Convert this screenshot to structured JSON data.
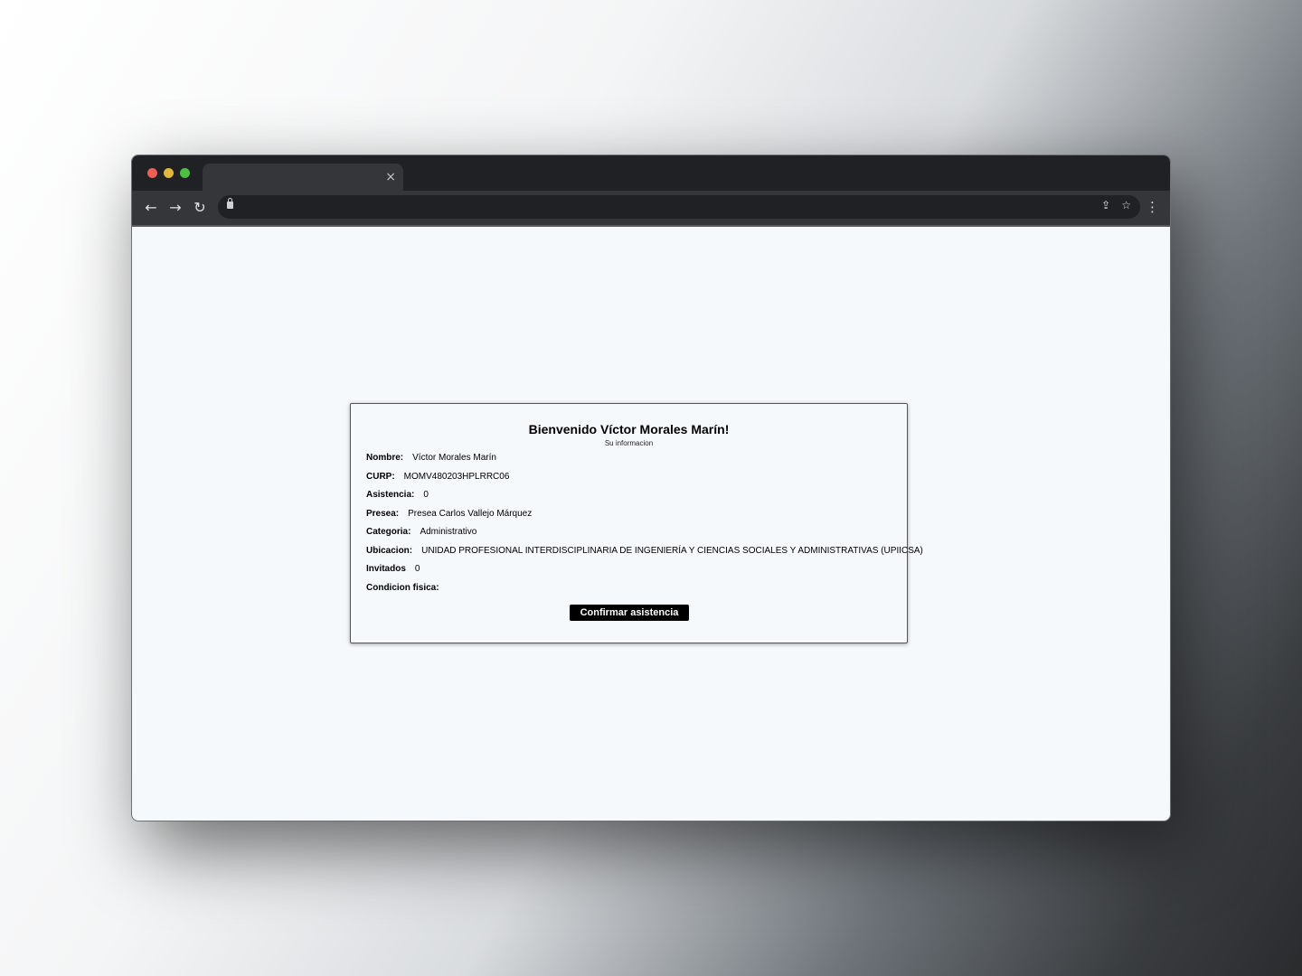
{
  "browser": {
    "tab_close": "×",
    "nav": {
      "back": "←",
      "forward": "→",
      "reload": "↻"
    },
    "omnibox_icons": {
      "share": "⇪",
      "bookmark": "☆"
    },
    "menu": "⋮"
  },
  "card": {
    "title": "Bienvenido Víctor Morales Marín!",
    "subtitle": "Su informacion",
    "fields": [
      {
        "label": "Nombre:",
        "value": "Víctor Morales Marín"
      },
      {
        "label": "CURP:",
        "value": "MOMV480203HPLRRC06"
      },
      {
        "label": "Asistencia:",
        "value": "0"
      },
      {
        "label": "Presea:",
        "value": "Presea Carlos Vallejo Márquez"
      },
      {
        "label": "Categoria:",
        "value": "Administrativo"
      },
      {
        "label": "Ubicacion:",
        "value": "UNIDAD PROFESIONAL INTERDISCIPLINARIA DE INGENIERÍA Y CIENCIAS SOCIALES Y ADMINISTRATIVAS (UPIICSA)"
      },
      {
        "label": "Invitados",
        "value": "0"
      },
      {
        "label": "Condicion fisica:",
        "value": ""
      }
    ],
    "confirm_label": "Confirmar asistencia"
  },
  "colors": {
    "titlebar": "#202124",
    "toolbar": "#35363a",
    "page_bg": "#f6f9fc",
    "button_bg": "#000000"
  }
}
